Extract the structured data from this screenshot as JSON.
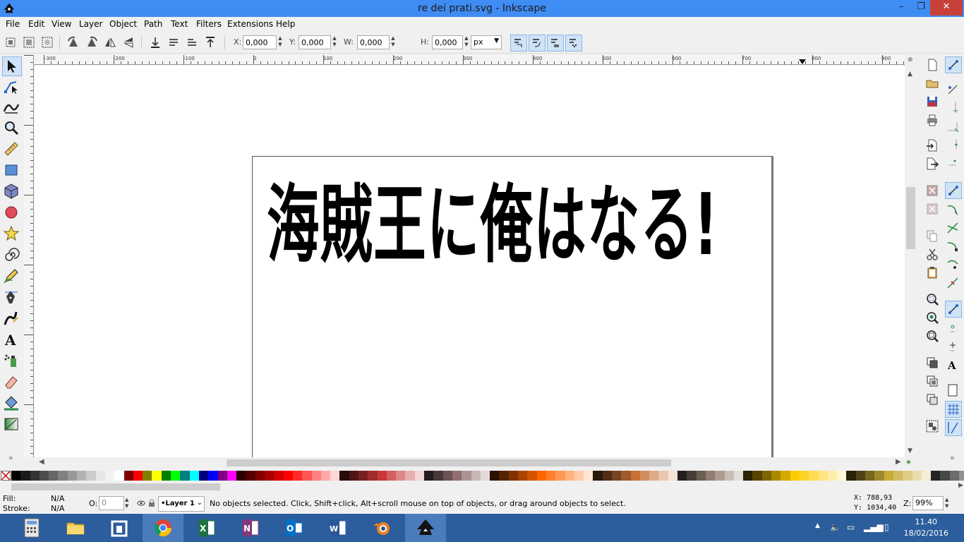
{
  "window": {
    "title": "re dei prati.svg - Inkscape",
    "minimize_glyph": "–",
    "maximize_glyph": "❐",
    "close_glyph": "✕"
  },
  "menu": [
    "File",
    "Edit",
    "View",
    "Layer",
    "Object",
    "Path",
    "Text",
    "Filters",
    "Extensions",
    "Help"
  ],
  "controls": {
    "x_label": "X:",
    "x_value": "0,000",
    "y_label": "Y:",
    "y_value": "0,000",
    "w_label": "W:",
    "w_value": "0,000",
    "h_label": "H:",
    "h_value": "0,000",
    "unit": "px"
  },
  "ruler": {
    "labels": [
      "-300",
      "-200",
      "-100",
      "0",
      "100",
      "200",
      "300",
      "400",
      "500",
      "600",
      "700",
      "800",
      "900"
    ]
  },
  "canvas": {
    "text": "海賊王に俺はなる!"
  },
  "palette": {
    "colors": [
      "#000000",
      "#1a1a1a",
      "#333333",
      "#4d4d4d",
      "#666666",
      "#808080",
      "#999999",
      "#b3b3b3",
      "#cccccc",
      "#e6e6e6",
      "#f2f2f2",
      "#ffffff",
      "#800000",
      "#ff0000",
      "#808000",
      "#ffff00",
      "#008000",
      "#00ff00",
      "#008080",
      "#00ffff",
      "#000080",
      "#0000ff",
      "#800080",
      "#ff00ff",
      "#2b0000",
      "#550000",
      "#800000",
      "#aa0000",
      "#d40000",
      "#ff0000",
      "#ff2a2a",
      "#ff5555",
      "#ff8080",
      "#ffaaaa",
      "#ffd5d5",
      "#280b0b",
      "#501616",
      "#782121",
      "#a02c2c",
      "#c83737",
      "#d35f5f",
      "#de8787",
      "#e9afaf",
      "#f4d7d7",
      "#241c1c",
      "#483737",
      "#6c5353",
      "#916f6f",
      "#ac9393",
      "#c8b7b7",
      "#e3dbdb",
      "#2b1100",
      "#552200",
      "#803300",
      "#aa4400",
      "#d45500",
      "#ff6600",
      "#ff7f2a",
      "#ff9955",
      "#ffb380",
      "#ffccaa",
      "#ffe6d5",
      "#28170b",
      "#502d16",
      "#784421",
      "#a05a2c",
      "#c87137",
      "#d38d5f",
      "#deaa87",
      "#e9c6af",
      "#f4e3d7",
      "#241f1c",
      "#483e37",
      "#6c5d53",
      "#917c6f",
      "#ac9d93",
      "#c8beb7",
      "#e3dedb",
      "#2b2200",
      "#554400",
      "#806600",
      "#aa8800",
      "#d4aa00",
      "#ffcc00",
      "#ffd42a",
      "#ffdd55",
      "#ffe680",
      "#ffeeaa",
      "#fff6d5",
      "#28220b",
      "#504416",
      "#786721",
      "#a0892c",
      "#c8ab37",
      "#d3bc5f",
      "#decd87",
      "#e9ddaf",
      "#f4eed7",
      "#242424",
      "#484848",
      "#6c6c6c",
      "#919191"
    ]
  },
  "status": {
    "fill_label": "Fill:",
    "fill_value": "N/A",
    "stroke_label": "Stroke:",
    "stroke_value": "N/A",
    "opacity_label": "O:",
    "opacity_value": "0",
    "layer": "•Layer 1",
    "message": "No objects selected. Click, Shift+click, Alt+scroll mouse on top of objects, or drag around objects to select.",
    "x_coord": "X:   788,93",
    "y_coord": "Y: 1034,40",
    "zoom_label": "Z:",
    "zoom_value": "99%"
  },
  "taskbar": {
    "time": "11.40",
    "date": "18/02/2016"
  }
}
